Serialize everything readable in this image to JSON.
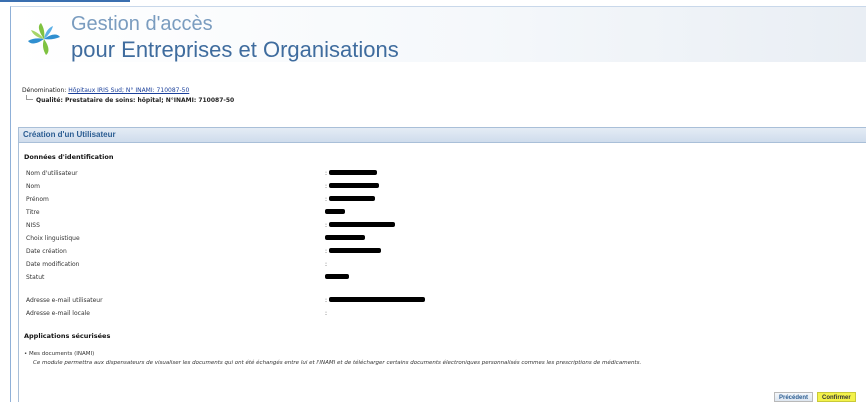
{
  "header": {
    "title_line1": "Gestion d'accès",
    "title_line2": "pour Entreprises et Organisations",
    "logo_icon": "pinwheel-logo-icon",
    "colors": {
      "green": "#7fc241",
      "blue": "#2f8fd0",
      "accent_blue": "#3f6c9e"
    }
  },
  "org": {
    "denomination_label": "Dénomination: ",
    "denomination_link": "Hôpitaux IRIS Sud; N° INAMI: 710087-50",
    "qualite": "Qualité: Prestataire de soins: hôpital; N°INAMI: 710087-50"
  },
  "panel": {
    "title": "Création d'un Utilisateur",
    "identification_title": "Données d'identification",
    "fields": [
      {
        "label": "Nom d'utilisateur",
        "value": "[redacted]"
      },
      {
        "label": "Nom",
        "value": "[redacted]"
      },
      {
        "label": "Prénom",
        "value": "[redacted]"
      },
      {
        "label": "Titre",
        "value": "[redacted]"
      },
      {
        "label": "NISS",
        "value": "[redacted]"
      },
      {
        "label": "Choix linguistique",
        "value": "[redacted]"
      },
      {
        "label": "Date création",
        "value": "[redacted]"
      },
      {
        "label": "Date modification",
        "value": ""
      },
      {
        "label": "Statut",
        "value": "[redacted]"
      }
    ],
    "email_fields": [
      {
        "label": "Adresse e-mail utilisateur",
        "value": "[redacted]"
      },
      {
        "label": "Adresse e-mail locale",
        "value": ""
      }
    ],
    "applications_title": "Applications sécurisées",
    "applications": [
      {
        "name": "• Mes documents (INAMI)",
        "description": "Ce module permettra aux dispensateurs de visualiser les documents qui ont été échangés entre lui et l'INAMI et de télécharger certains documents électroniques personnalisés commes les prescriptions de médicaments."
      }
    ],
    "buttons": {
      "previous": "Précédent",
      "confirm": "Confirmer"
    }
  }
}
